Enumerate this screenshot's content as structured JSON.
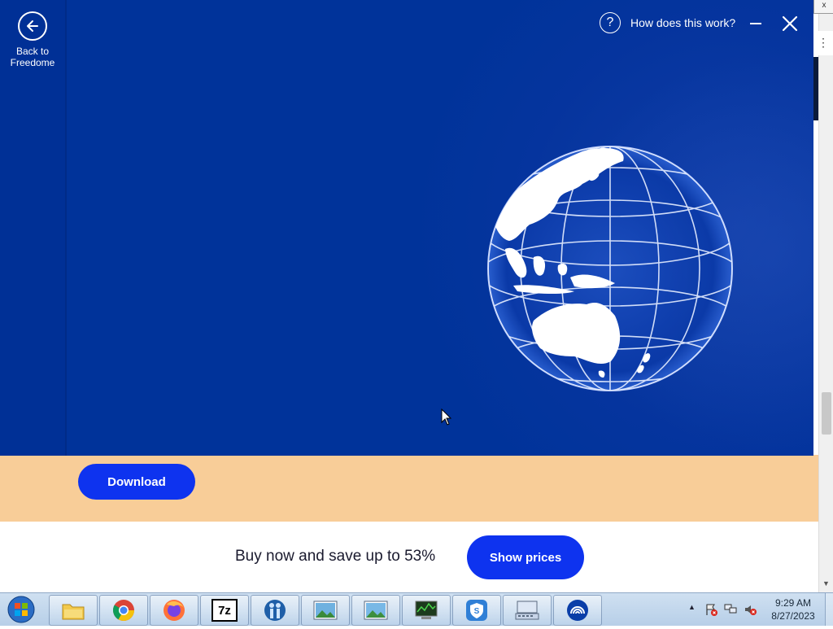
{
  "overlay": {
    "back_label_line1": "Back to",
    "back_label_line2": "Freedome",
    "help_label": "How does this work?",
    "help_icon": "question-icon",
    "colors": {
      "background": "#00339A",
      "accent": "#FFFFFF"
    }
  },
  "page": {
    "download_label": "Download",
    "promo_text": "Buy now and save up to 53%",
    "show_prices_label": "Show prices",
    "colors": {
      "button": "#0E33EF",
      "band": "#F8CD98"
    }
  },
  "browser": {
    "close_glyph": "x",
    "menu_glyph": "⋮"
  },
  "taskbar": {
    "items": [
      {
        "name": "file-explorer"
      },
      {
        "name": "chrome"
      },
      {
        "name": "firefox"
      },
      {
        "name": "7zip",
        "label": "7z"
      },
      {
        "name": "family-app"
      },
      {
        "name": "image-viewer-1"
      },
      {
        "name": "image-viewer-2"
      },
      {
        "name": "system-monitor"
      },
      {
        "name": "shield-app"
      },
      {
        "name": "keyboard-app"
      },
      {
        "name": "freedome"
      }
    ],
    "clock_time": "9:29 AM",
    "clock_date": "8/27/2023"
  }
}
